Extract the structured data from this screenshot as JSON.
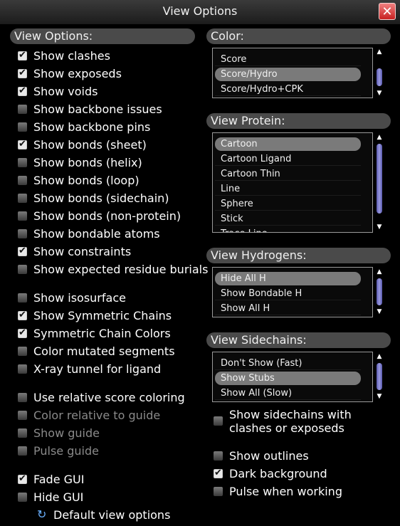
{
  "window": {
    "title": "View Options",
    "close_label": "✕"
  },
  "left": {
    "header": "View Options:",
    "options": [
      {
        "label": "Show clashes",
        "checked": true,
        "disabled": false
      },
      {
        "label": "Show exposeds",
        "checked": true,
        "disabled": false
      },
      {
        "label": "Show voids",
        "checked": true,
        "disabled": false
      },
      {
        "label": "Show backbone issues",
        "checked": false,
        "disabled": false
      },
      {
        "label": "Show backbone pins",
        "checked": false,
        "disabled": false
      },
      {
        "label": "Show bonds (sheet)",
        "checked": true,
        "disabled": false
      },
      {
        "label": "Show bonds (helix)",
        "checked": false,
        "disabled": false
      },
      {
        "label": "Show bonds (loop)",
        "checked": false,
        "disabled": false
      },
      {
        "label": "Show bonds (sidechain)",
        "checked": false,
        "disabled": false
      },
      {
        "label": "Show bonds (non-protein)",
        "checked": false,
        "disabled": false
      },
      {
        "label": "Show bondable atoms",
        "checked": false,
        "disabled": false
      },
      {
        "label": "Show constraints",
        "checked": true,
        "disabled": false
      },
      {
        "label": "Show expected residue burials",
        "checked": false,
        "disabled": false
      },
      {
        "label": "Show isosurface",
        "checked": false,
        "disabled": false
      },
      {
        "label": "Show Symmetric Chains",
        "checked": true,
        "disabled": false
      },
      {
        "label": "Symmetric Chain Colors",
        "checked": true,
        "disabled": false
      },
      {
        "label": "Color mutated segments",
        "checked": false,
        "disabled": false
      },
      {
        "label": "X-ray tunnel for ligand",
        "checked": false,
        "disabled": false
      },
      {
        "label": "Use relative score coloring",
        "checked": false,
        "disabled": false
      },
      {
        "label": "Color relative to guide",
        "checked": false,
        "disabled": true
      },
      {
        "label": "Show guide",
        "checked": false,
        "disabled": true
      },
      {
        "label": "Pulse guide",
        "checked": false,
        "disabled": true
      },
      {
        "label": "Fade GUI",
        "checked": true,
        "disabled": false
      },
      {
        "label": "Hide GUI",
        "checked": false,
        "disabled": false
      }
    ],
    "default_label": "Default view options",
    "default_icon": "refresh-icon"
  },
  "color": {
    "header": "Color:",
    "items": [
      "Score",
      "Score/Hydro",
      "Score/Hydro+CPK"
    ],
    "selected": 1
  },
  "protein": {
    "header": "View Protein:",
    "items": [
      "Cartoon",
      "Cartoon Ligand",
      "Cartoon Thin",
      "Line",
      "Sphere",
      "Stick",
      "Trace Line"
    ],
    "selected": 0
  },
  "hydrogens": {
    "header": "View Hydrogens:",
    "items": [
      "Hide All H",
      "Show Bondable H",
      "Show All H"
    ],
    "selected": 0
  },
  "sidechains": {
    "header": "View Sidechains:",
    "items": [
      "Don't Show (Fast)",
      "Show Stubs",
      "Show All (Slow)"
    ],
    "selected": 1
  },
  "right_options": [
    {
      "label": "Show sidechains with clashes or exposeds",
      "line1": "Show sidechains with",
      "line2": "clashes or exposeds",
      "checked": false
    },
    {
      "label": "Show outlines",
      "checked": false
    },
    {
      "label": "Dark background",
      "checked": true
    },
    {
      "label": "Pulse when working",
      "checked": false
    }
  ]
}
